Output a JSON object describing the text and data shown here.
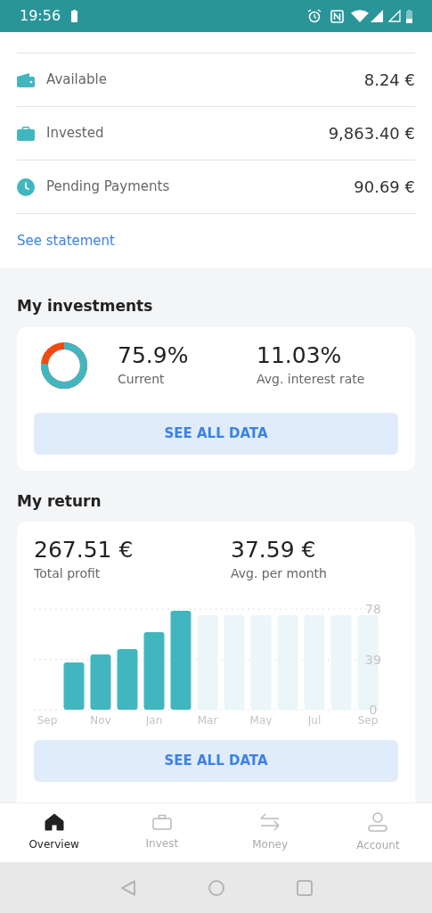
{
  "status_bar": {
    "time": "19:56"
  },
  "balances": [
    {
      "kind": "wallet",
      "label": "Available",
      "amount": "8.24 €"
    },
    {
      "kind": "briefcase",
      "label": "Invested",
      "amount": "9,863.40 €"
    },
    {
      "kind": "clock",
      "label": "Pending Payments",
      "amount": "90.69 €"
    }
  ],
  "statement_link": "See statement",
  "investments": {
    "title": "My investments",
    "stats": [
      {
        "value": "75.9%",
        "label": "Current"
      },
      {
        "value": "11.03%",
        "label": "Avg. interest rate"
      }
    ],
    "button": "SEE ALL DATA"
  },
  "return": {
    "title": "My return",
    "stats": [
      {
        "value": "267.51 €",
        "label": "Total profit"
      },
      {
        "value": "37.59 €",
        "label": "Avg. per month"
      }
    ],
    "chart_data": {
      "type": "bar",
      "categories": [
        "Sep",
        null,
        "Nov",
        null,
        "Jan",
        null,
        "Mar",
        null,
        "May",
        null,
        "Jul",
        null,
        "Sep"
      ],
      "series": [
        {
          "color": "#42b6bf",
          "values": [
            null,
            36.6,
            42.8,
            46.9,
            60,
            76.6,
            null,
            null,
            null,
            null,
            null,
            null,
            null
          ]
        },
        {
          "color": "#eaf6f8",
          "values": [
            null,
            null,
            null,
            null,
            null,
            null,
            73.2,
            73.2,
            73.2,
            73.2,
            73.2,
            73.2,
            73.2
          ]
        }
      ],
      "ylim": [
        0,
        78
      ],
      "yticks": [
        0,
        39,
        78
      ]
    },
    "button": "SEE ALL DATA"
  },
  "bottom_nav": [
    {
      "kind": "home",
      "label": "Overview",
      "selected": true
    },
    {
      "kind": "briefcase",
      "label": "Invest",
      "selected": false
    },
    {
      "kind": "arrows",
      "label": "Money",
      "selected": false
    },
    {
      "kind": "person",
      "label": "Account",
      "selected": false
    }
  ]
}
